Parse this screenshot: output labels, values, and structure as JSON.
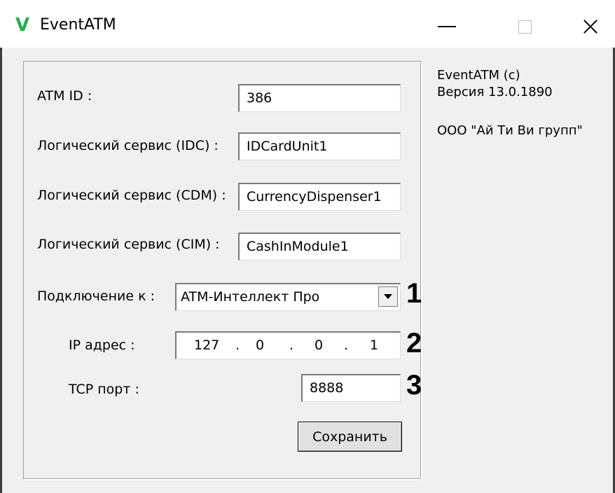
{
  "window": {
    "logo": "V",
    "title": "EventATM"
  },
  "form": {
    "atm_id_label": "ATM ID :",
    "atm_id_value": "386",
    "idc_label": "Логический сервис (IDC) :",
    "idc_value": "IDCardUnit1",
    "cdm_label": "Логический сервис (CDM) :",
    "cdm_value": "CurrencyDispenser1",
    "cim_label": "Логический сервис (CIM) :",
    "cim_value": "CashInModule1",
    "connect_label": "Подключение к :",
    "connect_value": "ATM-Интеллект Про",
    "ip_label": "IP адрес :",
    "ip_octets": [
      "127",
      "0",
      "0",
      "1"
    ],
    "ip_dot": ".",
    "tcp_label": "TCP порт :",
    "tcp_value": "8888",
    "save_label": "Сохранить"
  },
  "callouts": [
    "1",
    "2",
    "3"
  ],
  "info": {
    "line1": "EventATM (c)",
    "line2": "Версия 13.0.1890",
    "line3": "ООО \"Ай Ти Ви групп\""
  },
  "icons": {
    "minimize": "minimize-icon",
    "maximize": "maximize-icon",
    "close": "close-icon",
    "dropdown": "chevron-down-icon"
  },
  "colors": {
    "logo": "#22b14c",
    "background": "#f0f0f0"
  }
}
